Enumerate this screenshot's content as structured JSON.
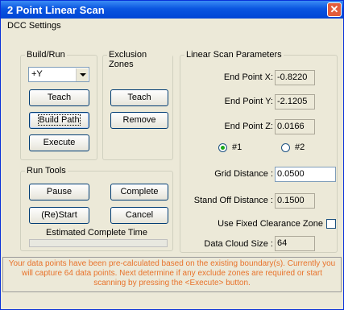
{
  "window": {
    "title": "2 Point Linear Scan",
    "close_glyph": "✕"
  },
  "menu": {
    "item": "DCC Settings"
  },
  "build_run": {
    "group_label": "Build/Run",
    "axis_select": "+Y",
    "teach": "Teach",
    "build_path": "Build Path",
    "execute": "Execute"
  },
  "exclusion": {
    "group_label": "Exclusion Zones",
    "teach": "Teach",
    "remove": "Remove"
  },
  "run_tools": {
    "group_label": "Run Tools",
    "pause": "Pause",
    "complete": "Complete",
    "restart": "(Re)Start",
    "cancel": "Cancel",
    "estimated_label": "Estimated Complete Time"
  },
  "linear": {
    "group_label": "Linear Scan Parameters",
    "end_x_label": "End Point X:",
    "end_x": "-0.8220",
    "end_y_label": "End Point Y:",
    "end_y": "-2.1205",
    "end_z_label": "End Point Z:",
    "end_z": "0.0166",
    "radio1": "#1",
    "radio2": "#2",
    "grid_label": "Grid Distance :",
    "grid": "0.0500",
    "standoff_label": "Stand Off Distance :",
    "standoff": "0.1500",
    "fixed_label": "Use Fixed Clearance Zone",
    "cloud_label": "Data Cloud Size :",
    "cloud": "64"
  },
  "status": {
    "message": "Your data points have been pre-calculated based on the existing boundary(s).  Currently you will capture 64 data points.  Next determine if any exclude zones are required or start scanning by pressing the <Execute> button."
  },
  "colors": {
    "title_bar": "#0a55e0",
    "status_text": "#e8722a",
    "radio_dot": "#1ba91b"
  }
}
